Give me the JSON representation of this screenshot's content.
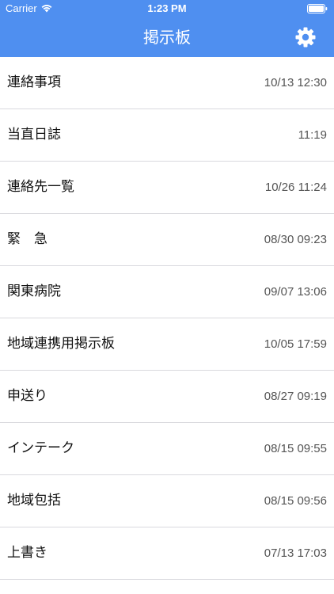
{
  "status_bar": {
    "carrier": "Carrier",
    "time": "1:23 PM",
    "wifi_icon": "wifi-icon",
    "battery_icon": "battery-icon"
  },
  "nav": {
    "title": "掲示板",
    "settings_icon": "gear-icon"
  },
  "colors": {
    "accent": "#4f8ff0",
    "separator": "#d9d9de"
  },
  "items": [
    {
      "title": "連絡事項",
      "time": "10/13 12:30"
    },
    {
      "title": "当直日誌",
      "time": "11:19"
    },
    {
      "title": "連絡先一覧",
      "time": "10/26 11:24"
    },
    {
      "title": "緊　急",
      "time": "08/30 09:23"
    },
    {
      "title": "関東病院",
      "time": "09/07 13:06"
    },
    {
      "title": "地域連携用掲示板",
      "time": "10/05 17:59"
    },
    {
      "title": "申送り",
      "time": "08/27 09:19"
    },
    {
      "title": "インテーク",
      "time": "08/15 09:55"
    },
    {
      "title": "地域包括",
      "time": "08/15 09:56"
    },
    {
      "title": "上書き",
      "time": "07/13 17:03"
    }
  ]
}
